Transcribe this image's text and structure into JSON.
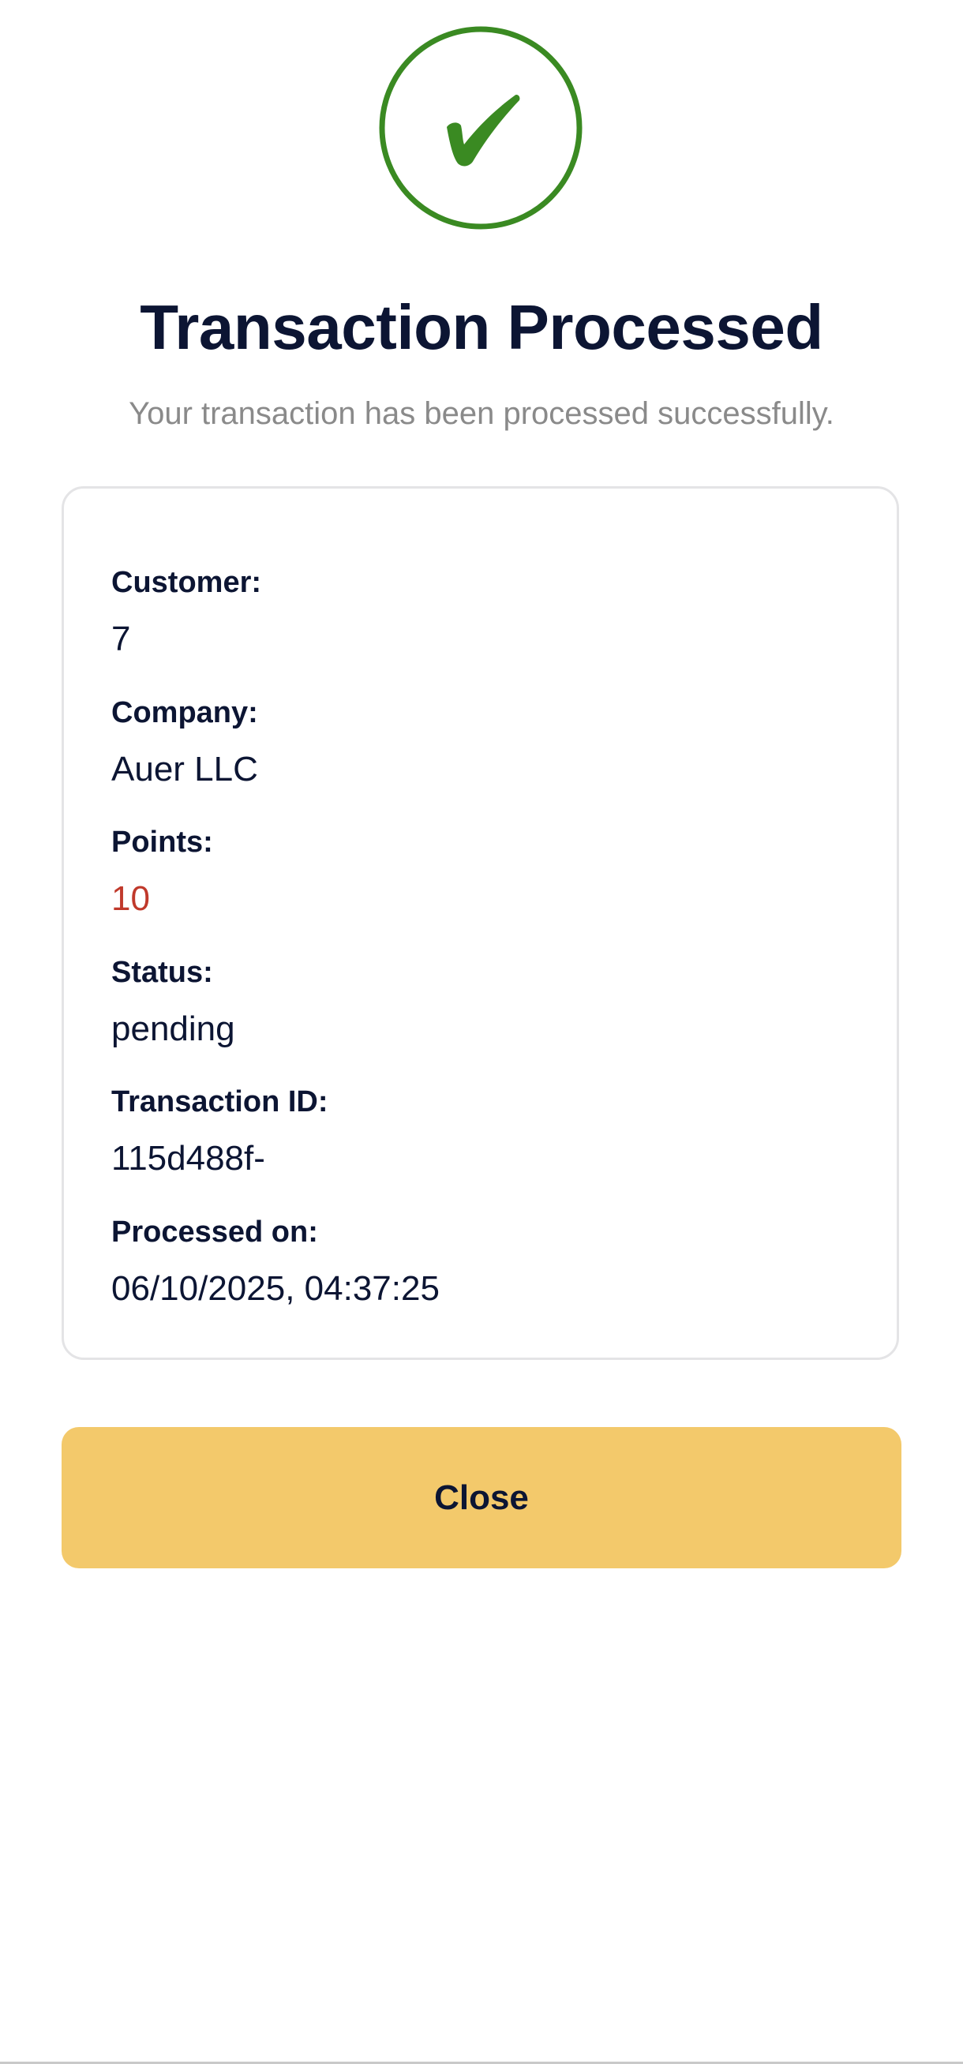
{
  "header": {
    "icon": "check-circle-icon",
    "title": "Transaction Processed",
    "subtitle": "Your transaction has been processed successfully."
  },
  "details": {
    "customer": {
      "label": "Customer:",
      "value": "7"
    },
    "company": {
      "label": "Company:",
      "value": "Auer LLC"
    },
    "points": {
      "label": "Points:",
      "value": "10"
    },
    "status": {
      "label": "Status:",
      "value": "pending"
    },
    "transaction_id": {
      "label": "Transaction ID:",
      "value": "115d488f-"
    },
    "processed_on": {
      "label": "Processed on:",
      "value": "06/10/2025, 04:37:25"
    }
  },
  "actions": {
    "close_label": "Close"
  },
  "colors": {
    "success": "#3a8a22",
    "title_text": "#0c1533",
    "subtitle_text": "#8a8a8a",
    "points_value": "#c0392b",
    "close_button_bg": "#f3c96b",
    "card_border": "#e4e4e6"
  }
}
